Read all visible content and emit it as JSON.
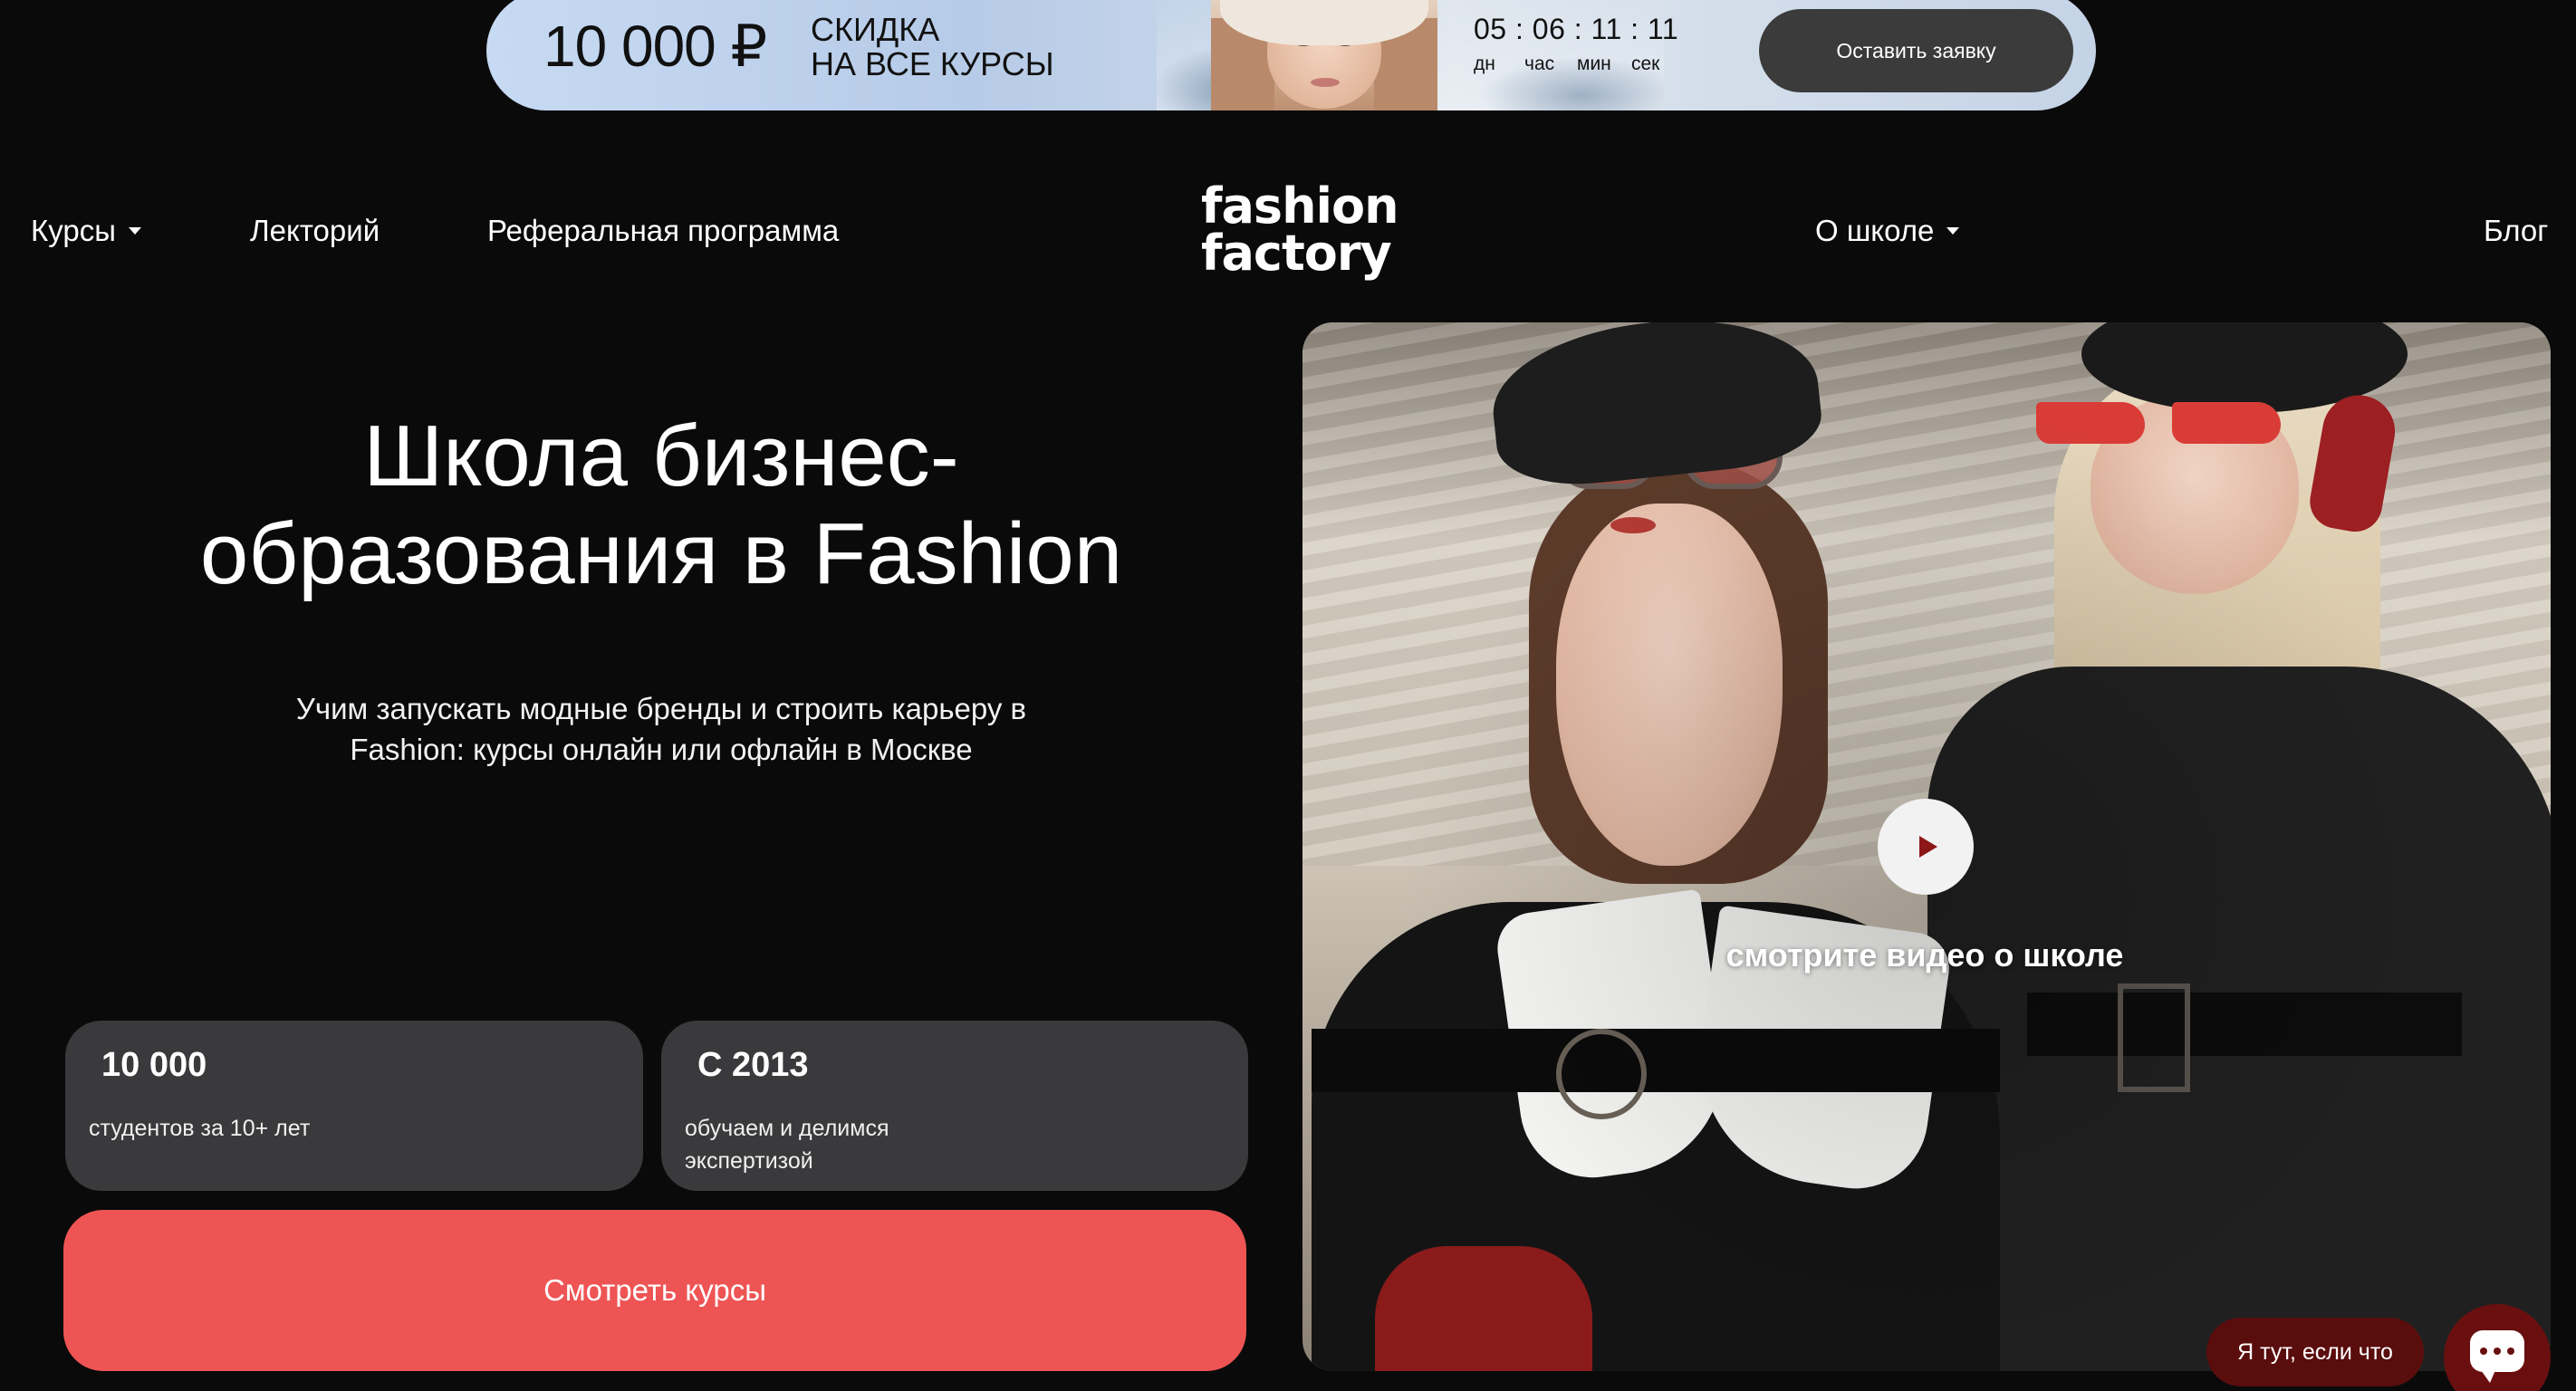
{
  "promo": {
    "amount": "10 000 ₽",
    "line1": "СКИДКА",
    "line2": "НА ВСЕ КУРСЫ",
    "timer": {
      "days": "05",
      "hours": "06",
      "minutes": "11",
      "seconds": "11",
      "sep": ":",
      "days_label": "дн",
      "hours_label": "час",
      "minutes_label": "мин",
      "seconds_label": "сек"
    },
    "button_label": "Оставить заявку",
    "colors": {
      "banner": "#c7daf3",
      "button": "#3b3b3b"
    }
  },
  "nav": {
    "courses": "Курсы",
    "lectures": "Лекторий",
    "referral": "Реферальная программа",
    "about": "О школе",
    "blog": "Блог"
  },
  "logo": {
    "line1": "fashion",
    "line2": "factory"
  },
  "hero": {
    "title_line1": "Школа бизнес-",
    "title_line2": "образования в Fashion",
    "subtitle_line1": "Учим запускать модные бренды и строить карьеру в",
    "subtitle_line2": "Fashion: курсы онлайн или офлайн в Москве"
  },
  "stats": [
    {
      "value": "10 000",
      "desc_line1": "студентов за 10+ лет",
      "desc_line2": ""
    },
    {
      "value": "С 2013",
      "desc_line1": "обучаем и делимся",
      "desc_line2": "экспертизой"
    }
  ],
  "cta": {
    "label": "Смотреть курсы",
    "color": "#ee5454"
  },
  "video": {
    "label": "смотрите видео о школе",
    "play_icon": "play-icon"
  },
  "chat": {
    "bubble_label": "Я тут, если что",
    "icon": "chat-icon",
    "color": "#6a0f0f"
  }
}
